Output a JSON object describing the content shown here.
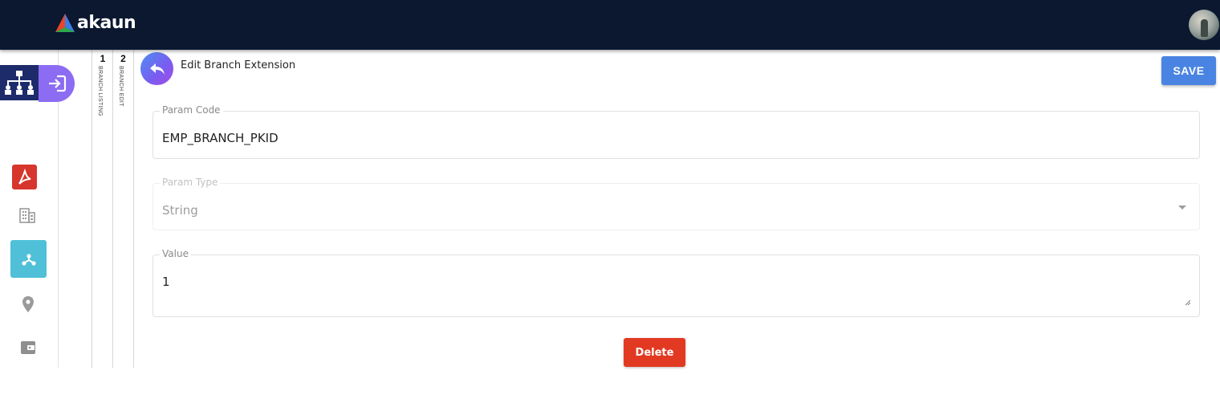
{
  "app": {
    "brand": "akaun"
  },
  "header": {
    "title": "Edit Branch Extension",
    "save_label": "SAVE"
  },
  "breadcrumbs": [
    {
      "number": "1",
      "label": "BRANCH LISTING"
    },
    {
      "number": "2",
      "label": "BRANCH EDIT"
    }
  ],
  "sidebar": {
    "items": [
      {
        "icon": "org-chart-icon",
        "active": false
      },
      {
        "icon": "acrobat-icon",
        "active": false
      },
      {
        "icon": "building-icon",
        "active": false
      },
      {
        "icon": "branch-icon",
        "active": true
      },
      {
        "icon": "location-pin-icon",
        "active": false
      },
      {
        "icon": "wallet-icon",
        "active": false
      }
    ]
  },
  "form": {
    "param_code": {
      "label": "Param Code",
      "value": "EMP_BRANCH_PKID"
    },
    "param_type": {
      "label": "Param Type",
      "value": "String",
      "disabled": true
    },
    "value": {
      "label": "Value",
      "value": "1"
    },
    "delete_label": "Delete"
  },
  "colors": {
    "topbar": "#0b1830",
    "save": "#4a84e2",
    "delete": "#e23a22",
    "active_sidebar": "#4fc0d8",
    "login_pill": "#8b6cf2"
  }
}
